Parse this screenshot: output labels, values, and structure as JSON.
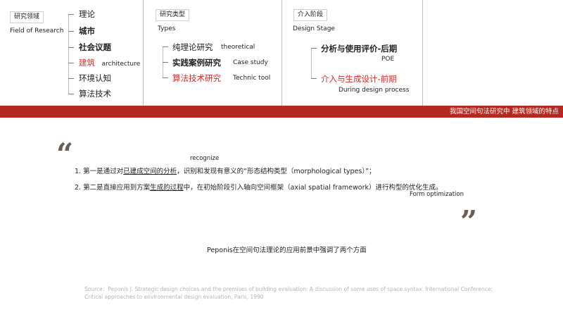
{
  "field": {
    "tag": "研究领域",
    "subtitle": "Field of Research",
    "items": [
      {
        "text": "理论",
        "en": ""
      },
      {
        "text": "城市",
        "en": ""
      },
      {
        "text": "社会议题",
        "en": ""
      },
      {
        "text": "建筑",
        "en": "architecture"
      },
      {
        "text": "环境认知",
        "en": ""
      },
      {
        "text": "算法技术",
        "en": ""
      }
    ]
  },
  "types": {
    "tag": "研究类型",
    "subtitle": "Types",
    "items": [
      {
        "text": "纯理论研究",
        "en": "theoretical"
      },
      {
        "text": "实践案例研究",
        "en": "Case study"
      },
      {
        "text": "算法技术研究",
        "en": "Technic tool"
      }
    ]
  },
  "stage": {
    "tag": "介入阶段",
    "subtitle": "Design Stage",
    "items": [
      {
        "text": "分析与使用评价-后期",
        "en": "POE"
      },
      {
        "text": "介入与生成设计-前期",
        "en": "During design process"
      }
    ]
  },
  "band_title": "我国空间句法研究中 建筑领域的特点",
  "quotes": {
    "open": "“",
    "close": "”"
  },
  "recognize_note": "recognize",
  "point1": {
    "pre": "1. 第一是通过对",
    "underlined": "已建成空间的分析",
    "post": "，识别和发现有意义的“形态结构类型（morphological types）”；"
  },
  "point2": {
    "pre": "2. 第二是直接应用到方案",
    "underlined": "生成的过程",
    "post": "中，在初始阶段引入轴向空间框架（axial spatial framework）进行构型的优化生成。"
  },
  "form_note": "Form optimization",
  "summary": "Peponis在空间句法理论的应用前景中强调了两个方面",
  "source_lines": [
    "Source：Peponis J. Strategic design choices and the premises of building evaluation: A discussion of some uses of space syntax. International Conference:",
    "Critical approaches to environmental design evaluation, Paris, 1990"
  ]
}
